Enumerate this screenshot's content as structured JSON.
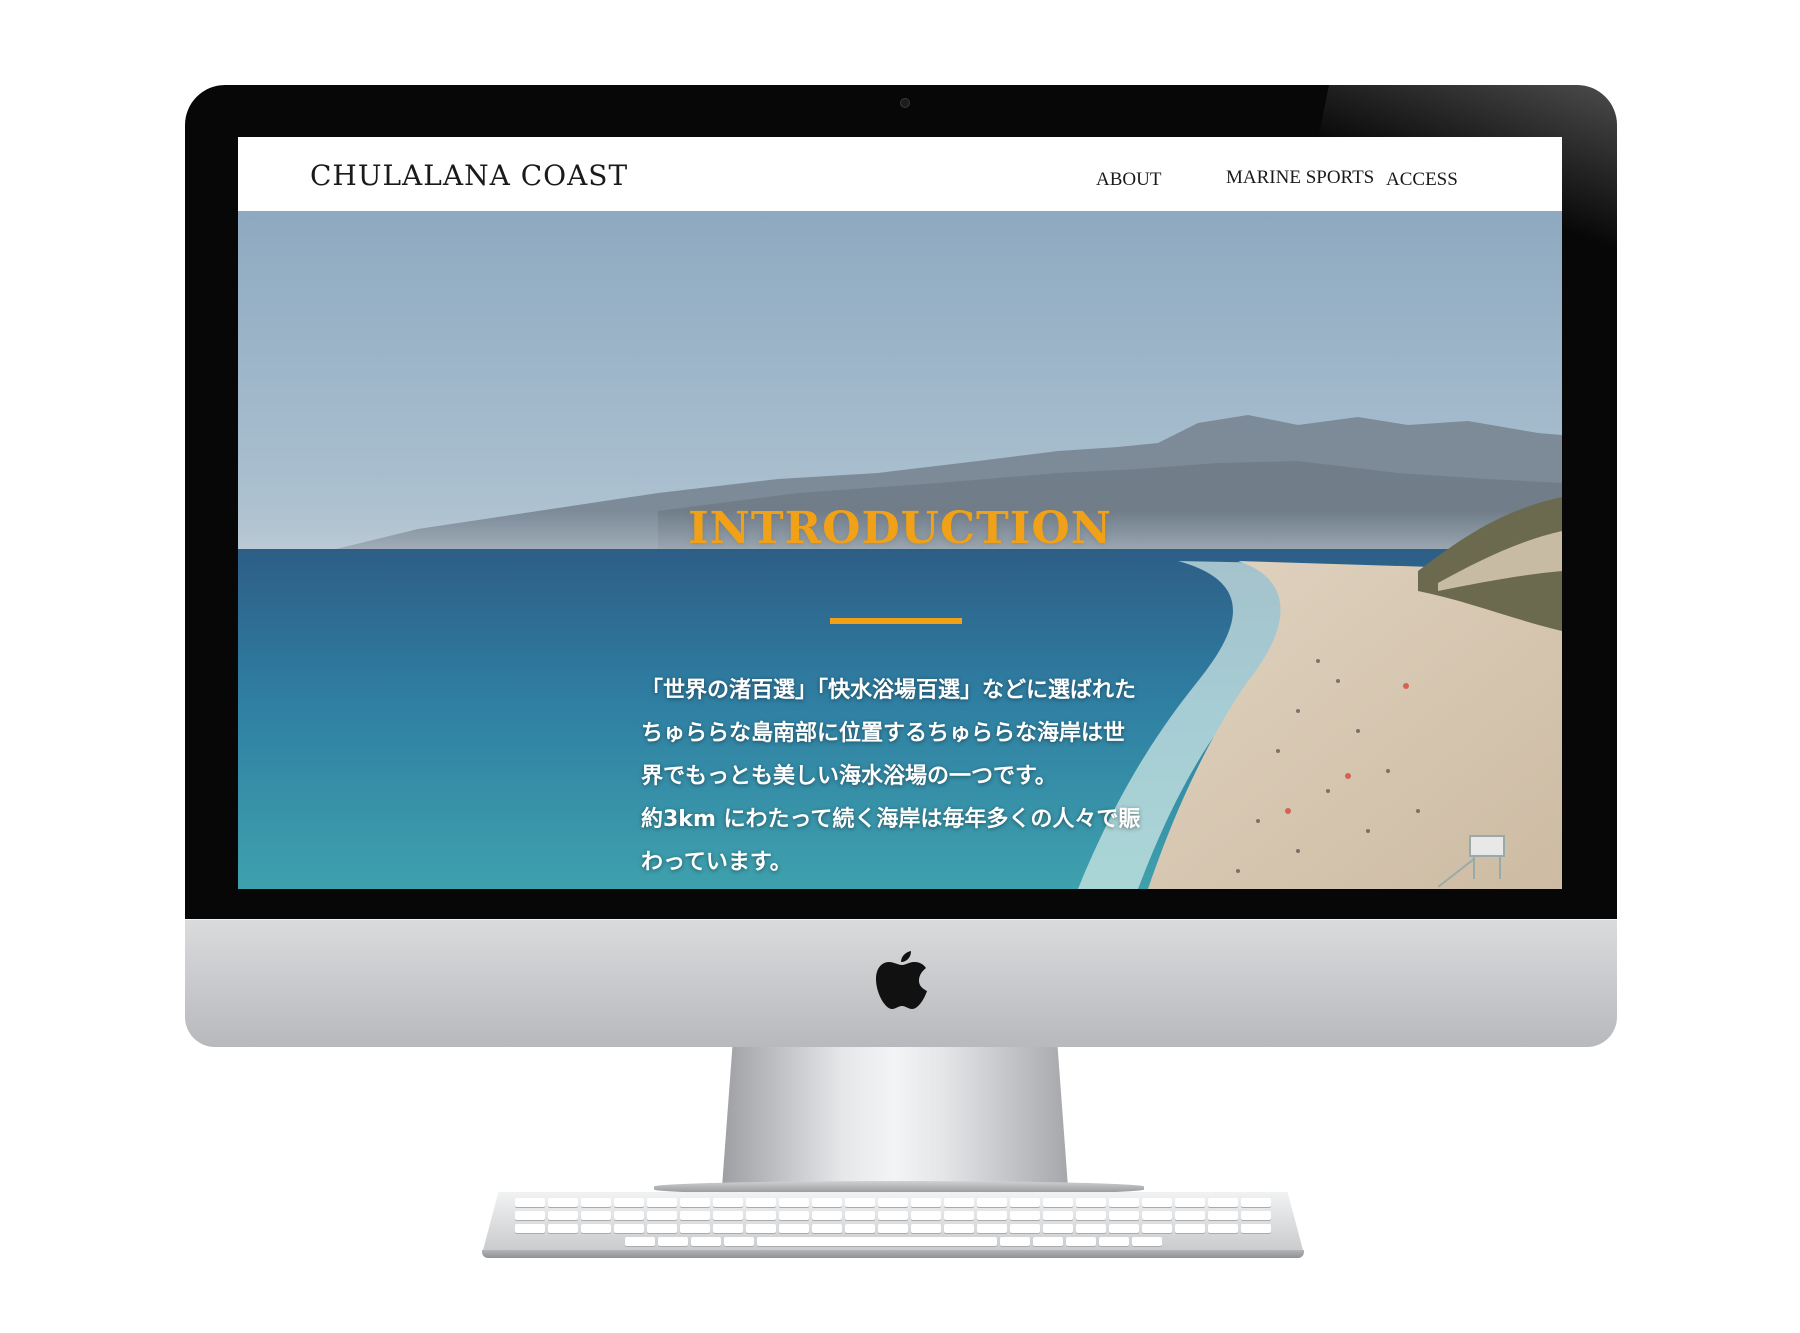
{
  "site": {
    "logo": "CHULALANA COAST",
    "nav": [
      "ABOUT",
      "MARINE SPORTS",
      "ACCESS"
    ]
  },
  "intro": {
    "title": "INTRODUCTION",
    "lines": [
      "「世界の渚百選」「快水浴場百選」などに選ばれた",
      "ちゅららな島南部に位置するちゅららな海岸は世",
      "界でもっとも美しい海水浴場の一つです。",
      "約3km にわたって続く海岸は毎年多くの人々で賑",
      "わっています。"
    ]
  },
  "colors": {
    "accent": "#f0a118",
    "header_bg": "#ffffff",
    "bezel": "#070707",
    "aluminum": "#c8cacc"
  },
  "icons": {
    "device_logo": "apple-logo-icon",
    "camera": "camera-dot"
  }
}
